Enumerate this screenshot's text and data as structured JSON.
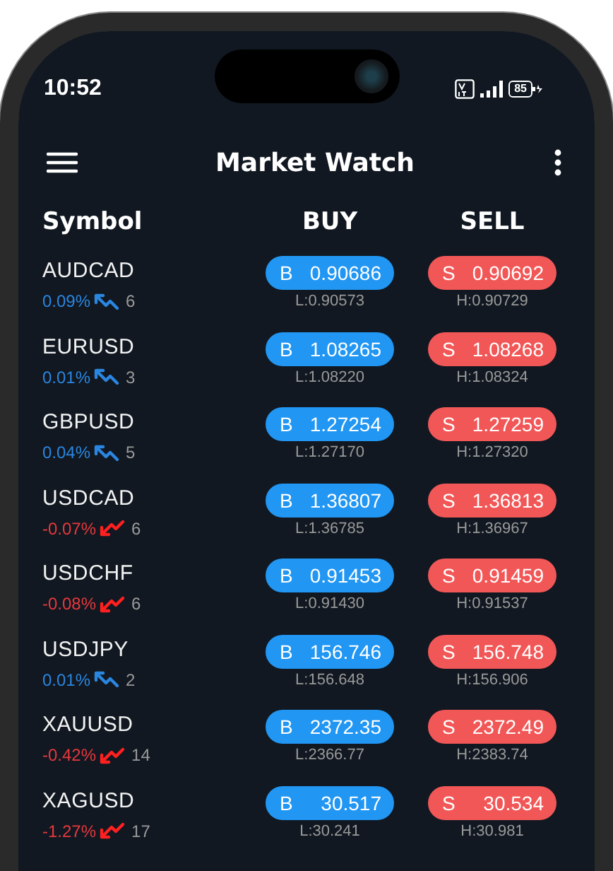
{
  "status_bar": {
    "time": "10:52",
    "battery": "85"
  },
  "app_bar": {
    "title": "Market Watch"
  },
  "columns": [
    "Symbol",
    "BUY",
    "SELL"
  ],
  "rows": [
    {
      "symbol": "AUDCAD",
      "change": "0.09%",
      "kind": "up",
      "count": "6",
      "buy_label": "B",
      "buy": "0.90686",
      "low": "L:0.90573",
      "sell_label": "S",
      "sell": "0.90692",
      "high": "H:0.90729"
    },
    {
      "symbol": "EURUSD",
      "change": "0.01%",
      "kind": "up",
      "count": "3",
      "buy_label": "B",
      "buy": "1.08265",
      "low": "L:1.08220",
      "sell_label": "S",
      "sell": "1.08268",
      "high": "H:1.08324"
    },
    {
      "symbol": "GBPUSD",
      "change": "0.04%",
      "kind": "up",
      "count": "5",
      "buy_label": "B",
      "buy": "1.27254",
      "low": "L:1.27170",
      "sell_label": "S",
      "sell": "1.27259",
      "high": "H:1.27320"
    },
    {
      "symbol": "USDCAD",
      "change": "-0.07%",
      "kind": "down",
      "count": "6",
      "buy_label": "B",
      "buy": "1.36807",
      "low": "L:1.36785",
      "sell_label": "S",
      "sell": "1.36813",
      "high": "H:1.36967"
    },
    {
      "symbol": "USDCHF",
      "change": "-0.08%",
      "kind": "down",
      "count": "6",
      "buy_label": "B",
      "buy": "0.91453",
      "low": "L:0.91430",
      "sell_label": "S",
      "sell": "0.91459",
      "high": "H:0.91537"
    },
    {
      "symbol": "USDJPY",
      "change": "0.01%",
      "kind": "up",
      "count": "2",
      "buy_label": "B",
      "buy": "156.746",
      "low": "L:156.648",
      "sell_label": "S",
      "sell": "156.748",
      "high": "H:156.906"
    },
    {
      "symbol": "XAUUSD",
      "change": "-0.42%",
      "kind": "down",
      "count": "14",
      "buy_label": "B",
      "buy": "2372.35",
      "low": "L:2366.77",
      "sell_label": "S",
      "sell": "2372.49",
      "high": "H:2383.74"
    },
    {
      "symbol": "XAGUSD",
      "change": "-1.27%",
      "kind": "down",
      "count": "17",
      "buy_label": "B",
      "buy": "30.517",
      "low": "L:30.241",
      "sell_label": "S",
      "sell": "30.534",
      "high": "H:30.981"
    }
  ]
}
